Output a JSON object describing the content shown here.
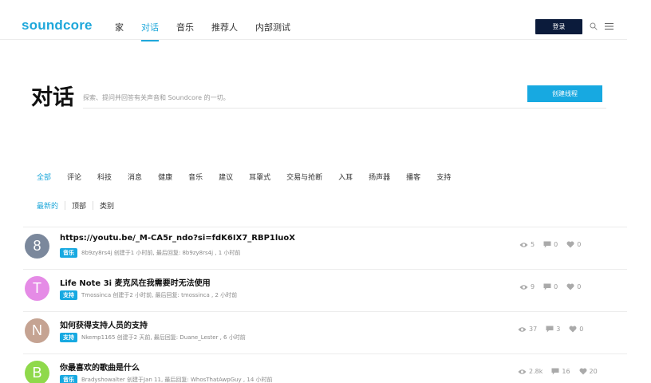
{
  "header": {
    "logo": "soundcore",
    "nav": [
      "家",
      "对话",
      "音乐",
      "推荐人",
      "内部测试"
    ],
    "active_nav": 1,
    "login": "登录"
  },
  "page": {
    "title": "对话",
    "subtitle": "探索、提问并回答有关声音和 Soundcore 的一切。",
    "create_button": "创建线程"
  },
  "categories": [
    "全部",
    "评论",
    "科技",
    "消息",
    "健康",
    "音乐",
    "建议",
    "耳罩式",
    "交易与抢断",
    "入耳",
    "扬声器",
    "播客",
    "支持"
  ],
  "active_category": 0,
  "sorts": [
    "最新的",
    "顶部",
    "类别"
  ],
  "active_sort": 0,
  "threads": [
    {
      "avatar_letter": "8",
      "avatar_color": "#7b889c",
      "title": "https://youtu.be/_M-CA5r_ndo?si=fdK6IX7_RBP1luoX",
      "tag": "音乐",
      "meta": "8b9zy8rs4j 创建于1 小时前, 最后回复: 8b9zy8rs4j , 1 小时前",
      "views": "5",
      "comments": "0",
      "likes": "0"
    },
    {
      "avatar_letter": "T",
      "avatar_color": "#e58be6",
      "title": "Life Note 3i 麦克风在我需要时无法使用",
      "tag": "支持",
      "meta": "Tmossinca 创建于2 小时前, 最后回复: tmossinca , 2 小时前",
      "views": "9",
      "comments": "0",
      "likes": "0"
    },
    {
      "avatar_letter": "N",
      "avatar_color": "#c5a392",
      "title": "如何获得支持人员的支持",
      "tag": "支持",
      "meta": "Nkemp1165 创建于2 天前, 最后回复: Duane_Lester , 6 小时前",
      "views": "37",
      "comments": "3",
      "likes": "0"
    },
    {
      "avatar_letter": "B",
      "avatar_color": "#8fd94b",
      "title": "你最喜欢的歌曲是什么",
      "tag": "音乐",
      "meta": "Bradyshowalter 创建于Jan 11, 最后回复: WhosThatAwpGuy , 14 小时前",
      "views": "2.8k",
      "comments": "16",
      "likes": "20"
    }
  ]
}
